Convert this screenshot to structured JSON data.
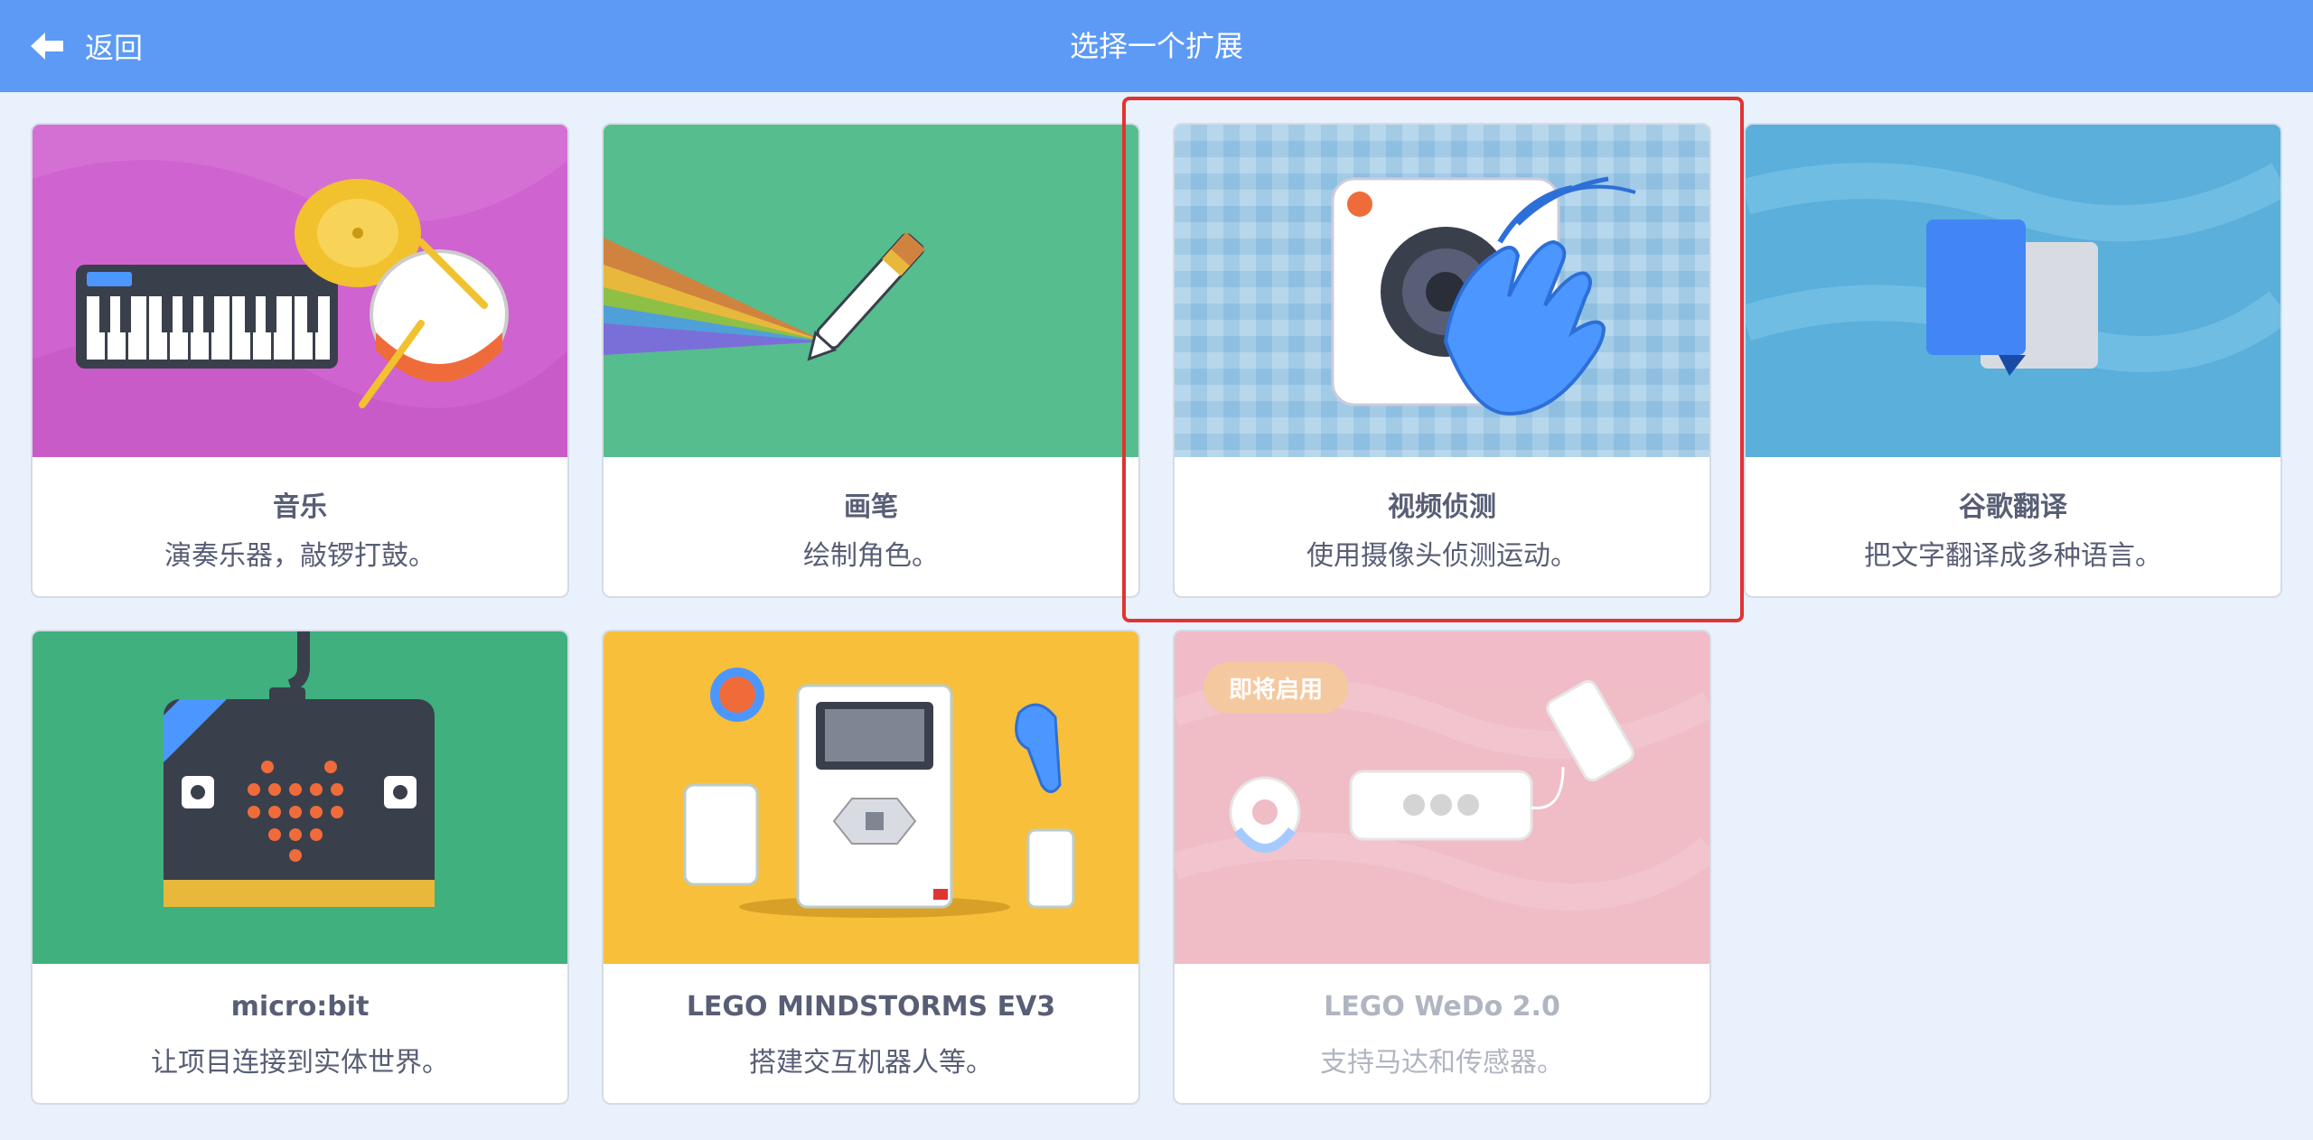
{
  "header": {
    "back_label": "返回",
    "title": "选择一个扩展"
  },
  "extensions": [
    {
      "name": "音乐",
      "desc": "演奏乐器，敲锣打鼓。",
      "art": "music-art"
    },
    {
      "name": "画笔",
      "desc": "绘制角色。",
      "art": "pen-art"
    },
    {
      "name": "视频侦测",
      "desc": "使用摄像头侦测运动。",
      "art": "video-sensing-art",
      "highlighted": true
    },
    {
      "name": "谷歌翻译",
      "desc": "把文字翻译成多种语言。",
      "art": "translate-art"
    },
    {
      "name": "micro:bit",
      "desc": "让项目连接到实体世界。",
      "art": "microbit-art"
    },
    {
      "name": "LEGO MINDSTORMS EV3",
      "desc": "搭建交互机器人等。",
      "art": "ev3-art"
    },
    {
      "name": "LEGO WeDo 2.0",
      "desc": "支持马达和传感器。",
      "art": "wedo-art",
      "badge": "即将启用",
      "disabled": true
    }
  ],
  "colors": {
    "header": "#5c9af5",
    "background": "#e9f1fc",
    "highlight": "#e03333",
    "text": "#575e75"
  }
}
